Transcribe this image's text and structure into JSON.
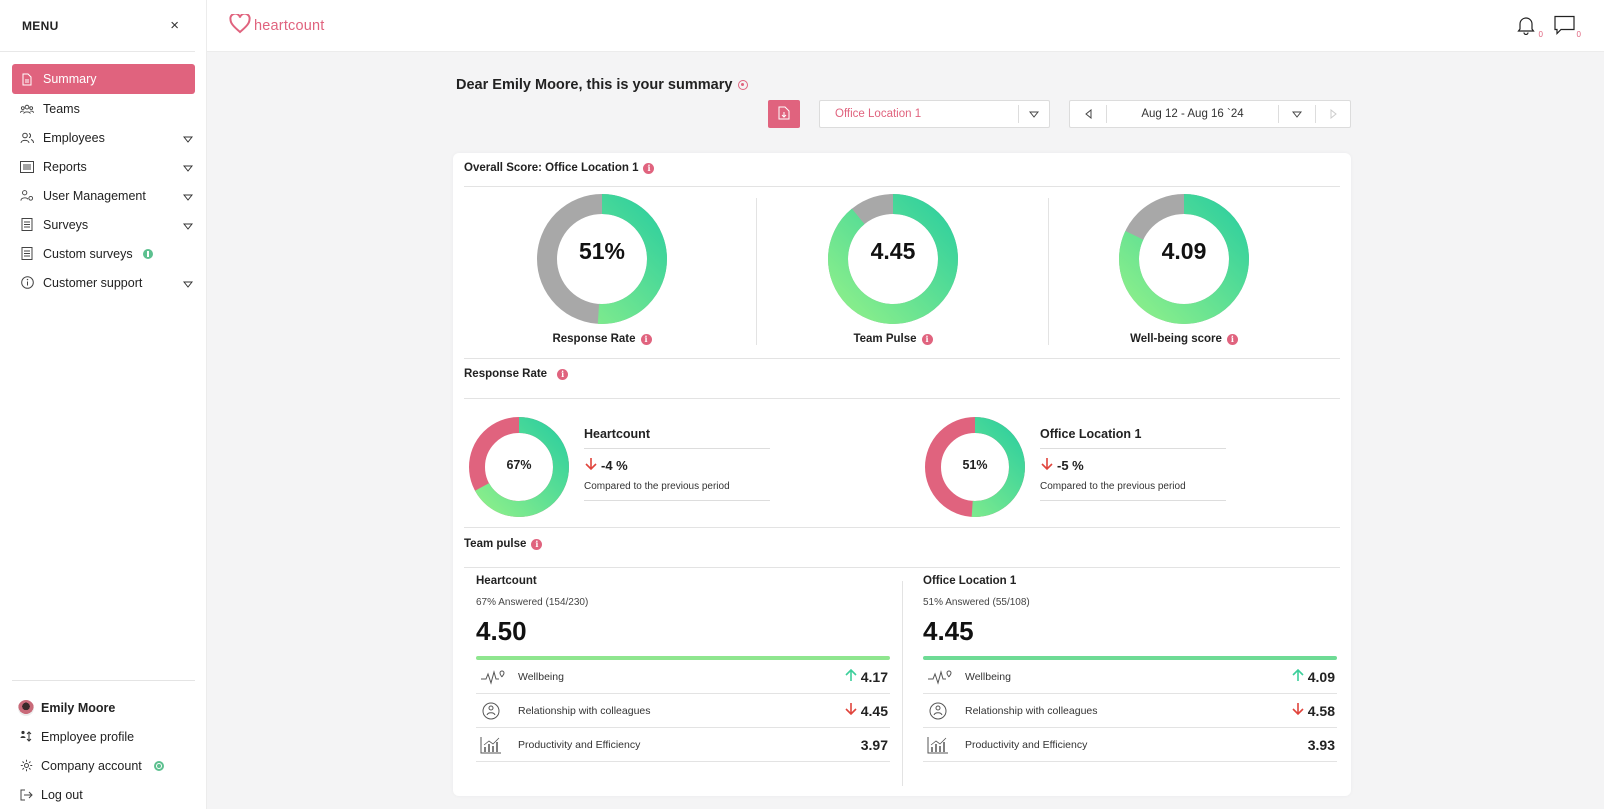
{
  "sidebar": {
    "title": "MENU",
    "close": "×",
    "items": [
      {
        "label": "Summary",
        "icon": "document-icon",
        "active": true
      },
      {
        "label": "Teams",
        "icon": "team-icon"
      },
      {
        "label": "Employees",
        "icon": "users-icon",
        "expandable": true
      },
      {
        "label": "Reports",
        "icon": "report-icon",
        "expandable": true
      },
      {
        "label": "User Management",
        "icon": "user-gear-icon",
        "expandable": true
      },
      {
        "label": "Surveys",
        "icon": "survey-icon",
        "expandable": true
      },
      {
        "label": "Custom surveys",
        "icon": "custom-survey-icon",
        "badge": "info"
      },
      {
        "label": "Customer support",
        "icon": "support-icon",
        "expandable": true
      }
    ],
    "bottom": {
      "user_name": "Emily Moore",
      "employee_profile": "Employee profile",
      "company_account": "Company account",
      "logout": "Log out"
    }
  },
  "topbar": {
    "logo_text": "heartcount",
    "notifications_count": "0",
    "messages_count": "0"
  },
  "header": {
    "greeting": "Dear Emily Moore, this is your summary",
    "location": "Office Location 1",
    "date_range": "Aug 12 - Aug 16 `24"
  },
  "overall": {
    "title": "Overall Score: Office Location 1",
    "response_rate": {
      "value": "51%",
      "label": "Response Rate",
      "fraction": 0.51
    },
    "team_pulse": {
      "value": "4.45",
      "label": "Team Pulse",
      "fraction": 0.89
    },
    "wellbeing": {
      "value": "4.09",
      "label": "Well-being score",
      "fraction": 0.82
    }
  },
  "response_rate": {
    "title": "Response Rate",
    "blocks": [
      {
        "name": "Heartcount",
        "percent": "67%",
        "fraction": 0.67,
        "delta": "-4 %",
        "compare": "Compared to the previous period"
      },
      {
        "name": "Office Location 1",
        "percent": "51%",
        "fraction": 0.51,
        "delta": "-5 %",
        "compare": "Compared to the previous period"
      }
    ]
  },
  "team_pulse": {
    "title": "Team pulse",
    "columns": [
      {
        "name": "Heartcount",
        "answered": "67% Answered (154/230)",
        "score": "4.50",
        "bar_color": "#8fe68f",
        "rows": [
          {
            "label": "Wellbeing",
            "value": "4.17",
            "trend": "up"
          },
          {
            "label": "Relationship with colleagues",
            "value": "4.45",
            "trend": "down"
          },
          {
            "label": "Productivity and Efficiency",
            "value": "3.97",
            "trend": "none"
          }
        ]
      },
      {
        "name": "Office Location 1",
        "answered": "51% Answered (55/108)",
        "score": "4.45",
        "bar_color": "#6edb95",
        "rows": [
          {
            "label": "Wellbeing",
            "value": "4.09",
            "trend": "up"
          },
          {
            "label": "Relationship with colleagues",
            "value": "4.58",
            "trend": "down"
          },
          {
            "label": "Productivity and Efficiency",
            "value": "3.93",
            "trend": "none"
          }
        ]
      }
    ]
  },
  "colors": {
    "accent": "#e0637e",
    "green": "#3ccf9b",
    "gray": "#a8a8a8",
    "up": "#3ccf9b",
    "down": "#e0443c"
  }
}
